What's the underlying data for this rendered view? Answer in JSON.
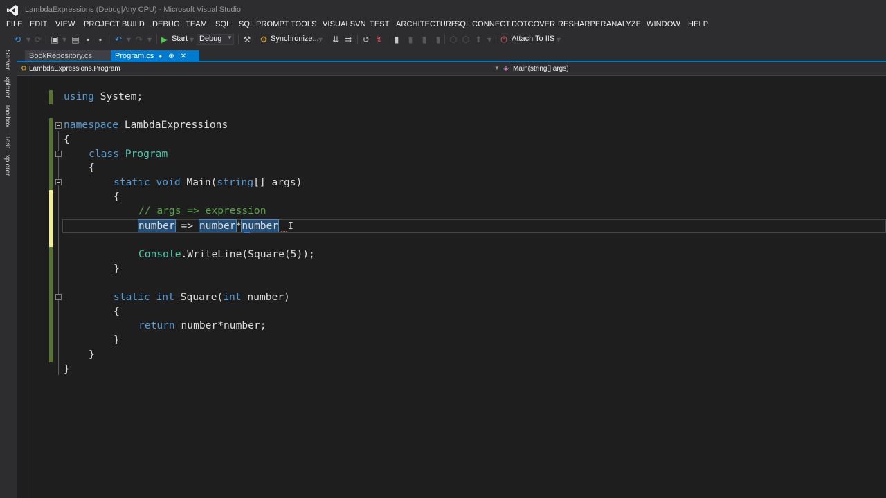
{
  "window": {
    "title": "LambdaExpressions (Debug|Any CPU) - Microsoft Visual Studio"
  },
  "menu": [
    "FILE",
    "EDIT",
    "VIEW",
    "PROJECT",
    "BUILD",
    "DEBUG",
    "TEAM",
    "SQL",
    "SQL PROMPT",
    "TOOLS",
    "VISUALSVN",
    "TEST",
    "ARCHITECTURE",
    "SQL CONNECT",
    "DOTCOVER",
    "RESHARPER",
    "ANALYZE",
    "WINDOW",
    "HELP"
  ],
  "toolbar": {
    "start_label": "Start",
    "configuration": "Debug",
    "synchronize_label": "Synchronize...",
    "attach_label": "Attach To IIS"
  },
  "left_dock": [
    "Server Explorer",
    "Toolbox",
    "Test Explorer"
  ],
  "tabs": [
    {
      "label": "BookRepository.cs",
      "active": false
    },
    {
      "label": "Program.cs",
      "active": true,
      "modified_marker": "●",
      "pin": "⊕",
      "close": "✕"
    }
  ],
  "nav": {
    "class": "LambdaExpressions.Program",
    "method": "Main(string[] args)"
  },
  "code": {
    "l1_kw": "using",
    "l1_rest": " System;",
    "l3_kw": "namespace",
    "l3_rest": " LambdaExpressions",
    "l4": "{",
    "l5_kw": "class",
    "l5_ty": "Program",
    "l6": "{",
    "l7_kw1": "static",
    "l7_kw2": "void",
    "l7_name": "Main(",
    "l7_kw3": "string",
    "l7_rest": "[] args)",
    "l8": "{",
    "l9_comment": "// args => expression",
    "l10_a": "number",
    "l10_arrow": " => ",
    "l10_b": "number",
    "l10_op": "*",
    "l10_c": "number",
    "l12_ty": "Console",
    "l12_rest": ".WriteLine(Square(5));",
    "l13": "}",
    "l15_kw1": "static",
    "l15_kw2": "int",
    "l15_name": "Square(",
    "l15_kw3": "int",
    "l15_rest": " number)",
    "l16": "{",
    "l17_kw": "return",
    "l17_rest": " number*number;",
    "l18": "}",
    "l19": "}",
    "l20": "}"
  },
  "colors": {
    "accent": "#007acc",
    "keyword": "#569cd6",
    "type": "#4ec9b0",
    "comment": "#57a64a",
    "saved_change": "#577430",
    "unsaved_change": "#efef91"
  }
}
